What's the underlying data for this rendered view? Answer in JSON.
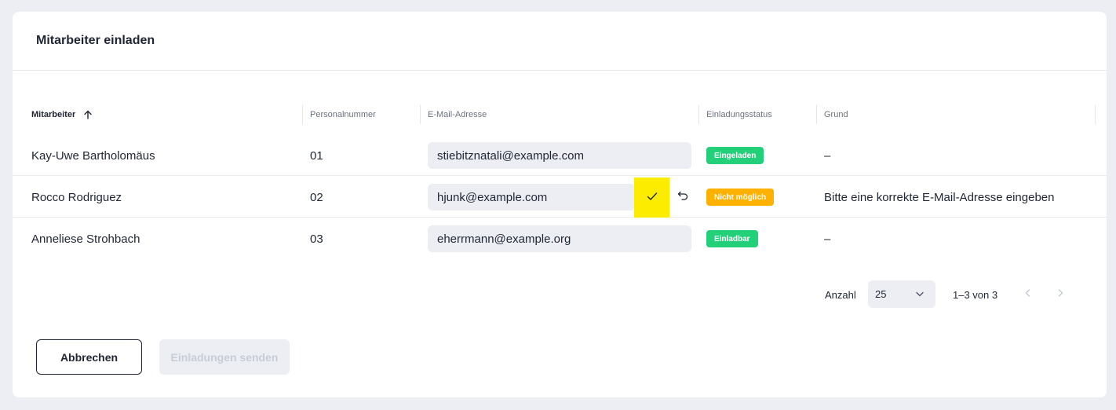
{
  "dialog": {
    "title": "Mitarbeiter einladen"
  },
  "table": {
    "columns": {
      "employee": "Mitarbeiter",
      "number": "Personalnummer",
      "email": "E-Mail-Adresse",
      "status": "Einladungsstatus",
      "reason": "Grund"
    },
    "rows": [
      {
        "name": "Kay-Uwe Bartholomäus",
        "number": "01",
        "email": "stiebitznatali@example.com",
        "status": "Eingeladen",
        "status_color": "#22d07a",
        "reason": "–"
      },
      {
        "name": "Rocco Rodriguez",
        "number": "02",
        "email": "hjunk@example.com",
        "status": "Nicht möglich",
        "status_color": "#ffb100",
        "reason": "Bitte eine korrekte E-Mail-Adresse eingeben"
      },
      {
        "name": "Anneliese Strohbach",
        "number": "03",
        "email": "eherrmann@example.org",
        "status": "Einladbar",
        "status_color": "#22d07a",
        "reason": "–"
      }
    ]
  },
  "pagination": {
    "label": "Anzahl",
    "page_size": "25",
    "range": "1–3 von 3"
  },
  "actions": {
    "cancel": "Abbrechen",
    "send": "Einladungen senden"
  },
  "icons": {
    "sort": "arrow-up-icon",
    "confirm": "check-icon",
    "undo": "undo-icon",
    "select": "chevron-down-icon",
    "prev": "chevron-left-icon",
    "next": "chevron-right-icon"
  },
  "colors": {
    "confirm_highlight": "#fcec00",
    "background": "#eceef3"
  }
}
